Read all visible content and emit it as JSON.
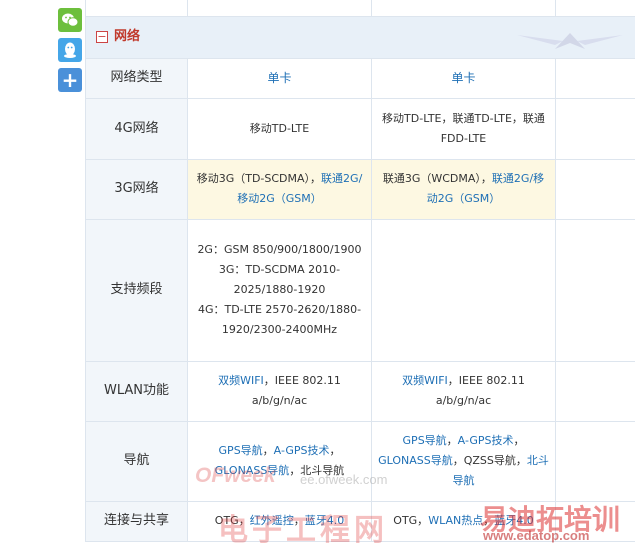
{
  "share": {
    "wechat_icon": "wechat-icon",
    "qq_icon": "qq-icon",
    "more_label": "+"
  },
  "section": {
    "toggle": "−",
    "title": "网络",
    "emblem": "wings-emblem"
  },
  "header": {
    "label": "网络类型",
    "col1": "单卡",
    "col2": "单卡"
  },
  "rows": [
    {
      "label": "4G网络",
      "col1": "移动TD-LTE",
      "col2": "移动TD-LTE，联通TD-LTE，联通FDD-LTE"
    },
    {
      "label": "3G网络",
      "col1_plain": "移动3G（TD-SCDMA），",
      "col1_link": "联通2G/移动2G（GSM）",
      "col2_plain": "联通3G（WCDMA），",
      "col2_link": "联通2G/移动2G（GSM）"
    },
    {
      "label": "支持频段",
      "col1_line1": "2G：GSM 850/900/1800/1900",
      "col1_line2": "3G：TD-SCDMA 2010-2025/1880-1920",
      "col1_line3": "4G：TD-LTE 2570-2620/1880-1920/2300-2400MHz",
      "col2": ""
    },
    {
      "label": "WLAN功能",
      "col1_link": "双频WIFI",
      "col1_plain": "，IEEE 802.11 a/b/g/n/ac",
      "col2_link": "双频WIFI",
      "col2_plain": "，IEEE 802.11 a/b/g/n/ac"
    },
    {
      "label": "导航",
      "col1_link1": "GPS导航",
      "col1_sep1": "，",
      "col1_link2": "A-GPS技术",
      "col1_sep2": "，",
      "col1_link3": "GLONASS导航",
      "col1_sep3": "，北斗导航",
      "col2_link1": "GPS导航",
      "col2_sep1": "，",
      "col2_link2": "A-GPS技术",
      "col2_sep2": "，",
      "col2_link3": "GLONASS导航",
      "col2_sep3": "，QZSS导航，",
      "col2_link4": "北斗导航"
    },
    {
      "label": "连接与共享",
      "col1_plain1": "OTG，",
      "col1_link1": "红外遥控",
      "col1_plain2": "，",
      "col1_link2": "蓝牙4.0",
      "col2_plain1": "OTG，",
      "col2_link1": "WLAN热点",
      "col2_plain2": "，",
      "col2_link2": "蓝牙4.0"
    }
  ],
  "watermarks": {
    "ofweek": "OFweek",
    "ofweek_url": "ee.ofweek.com",
    "dzgc": "电子工程网",
    "edatop": "易迪拓培训",
    "edatop_url": "www.edatop.com"
  }
}
